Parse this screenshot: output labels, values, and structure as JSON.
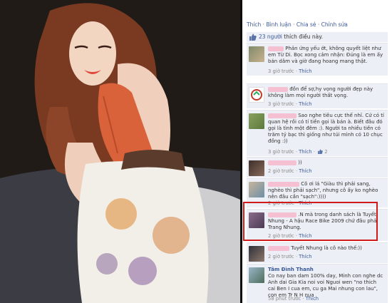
{
  "actions": {
    "like": "Thích",
    "comment": "Bình luận",
    "share": "Chia sẻ",
    "edit": "Chỉnh sửa",
    "sep": " · "
  },
  "likes": {
    "count_text": "23 người",
    "suffix": "thích điều này."
  },
  "comments": [
    {
      "name": "",
      "text": "Phản ứng yếu ớt, không quyết liệt như em Từ Di. Bọc xong cảm nhận: Đúng là em ấy bán dâm và giờ đang hoang mang thật.",
      "time": "3 giờ trước",
      "like": "Thích"
    },
    {
      "name": "",
      "text": "đồn để sợ,hy vọng người đẹp này không làm mọi người thất vọng.",
      "time": "3 giờ trước",
      "like": "Thích"
    },
    {
      "name": "",
      "text": "Sao nghe tiêu cực thế nhỉ. Cứ có tí quan hệ rồi có tí tiền gọi là bán à. Biết đâu đó gọi là tình một đêm :). Người ta nhiều tiền có trăm tỷ bạc thì giống như túi mình có 10 chục đồng :))",
      "time": "3 giờ trước",
      "like": "Thích",
      "extra": "2"
    },
    {
      "name": "",
      "text": "))",
      "time": "2 giờ trước",
      "like": "Thích"
    },
    {
      "name": "",
      "text": "Cô ơi lá \"Giàu thì phải sang, nghèo thì phải sạch\", nhưng cô ấy ko nghèo nên đâu cần \"sạch\":))))",
      "time": "2 giờ trước",
      "like": "Thích"
    },
    {
      "name": "",
      "text": ".N mà trong danh sách là Tuyết Nhung - A hậu Race Bike 2009 chứ đâu phải Trang Nhung.",
      "time": "2 giờ trước",
      "like": "Thích"
    },
    {
      "name": "",
      "text": "Tuyết Nhung là cô nào thế:))",
      "time": "2 giờ trước",
      "like": "Thích"
    },
    {
      "name": "Tâm Đình Thanh",
      "text": "Co nay ban dam 100% day, Minh con nghe dc Anh dai Gia Kia noi voi Nguoi wen \"no thich cai Ben I cua em, cu ga Mai nhung con lau\", con em Tr N H nua",
      "time": "58 phút trước",
      "like": "Thích"
    }
  ],
  "colors": {
    "link": "#3b5998",
    "comment_bg": "#eceff5",
    "highlight": "#d11b1b"
  }
}
